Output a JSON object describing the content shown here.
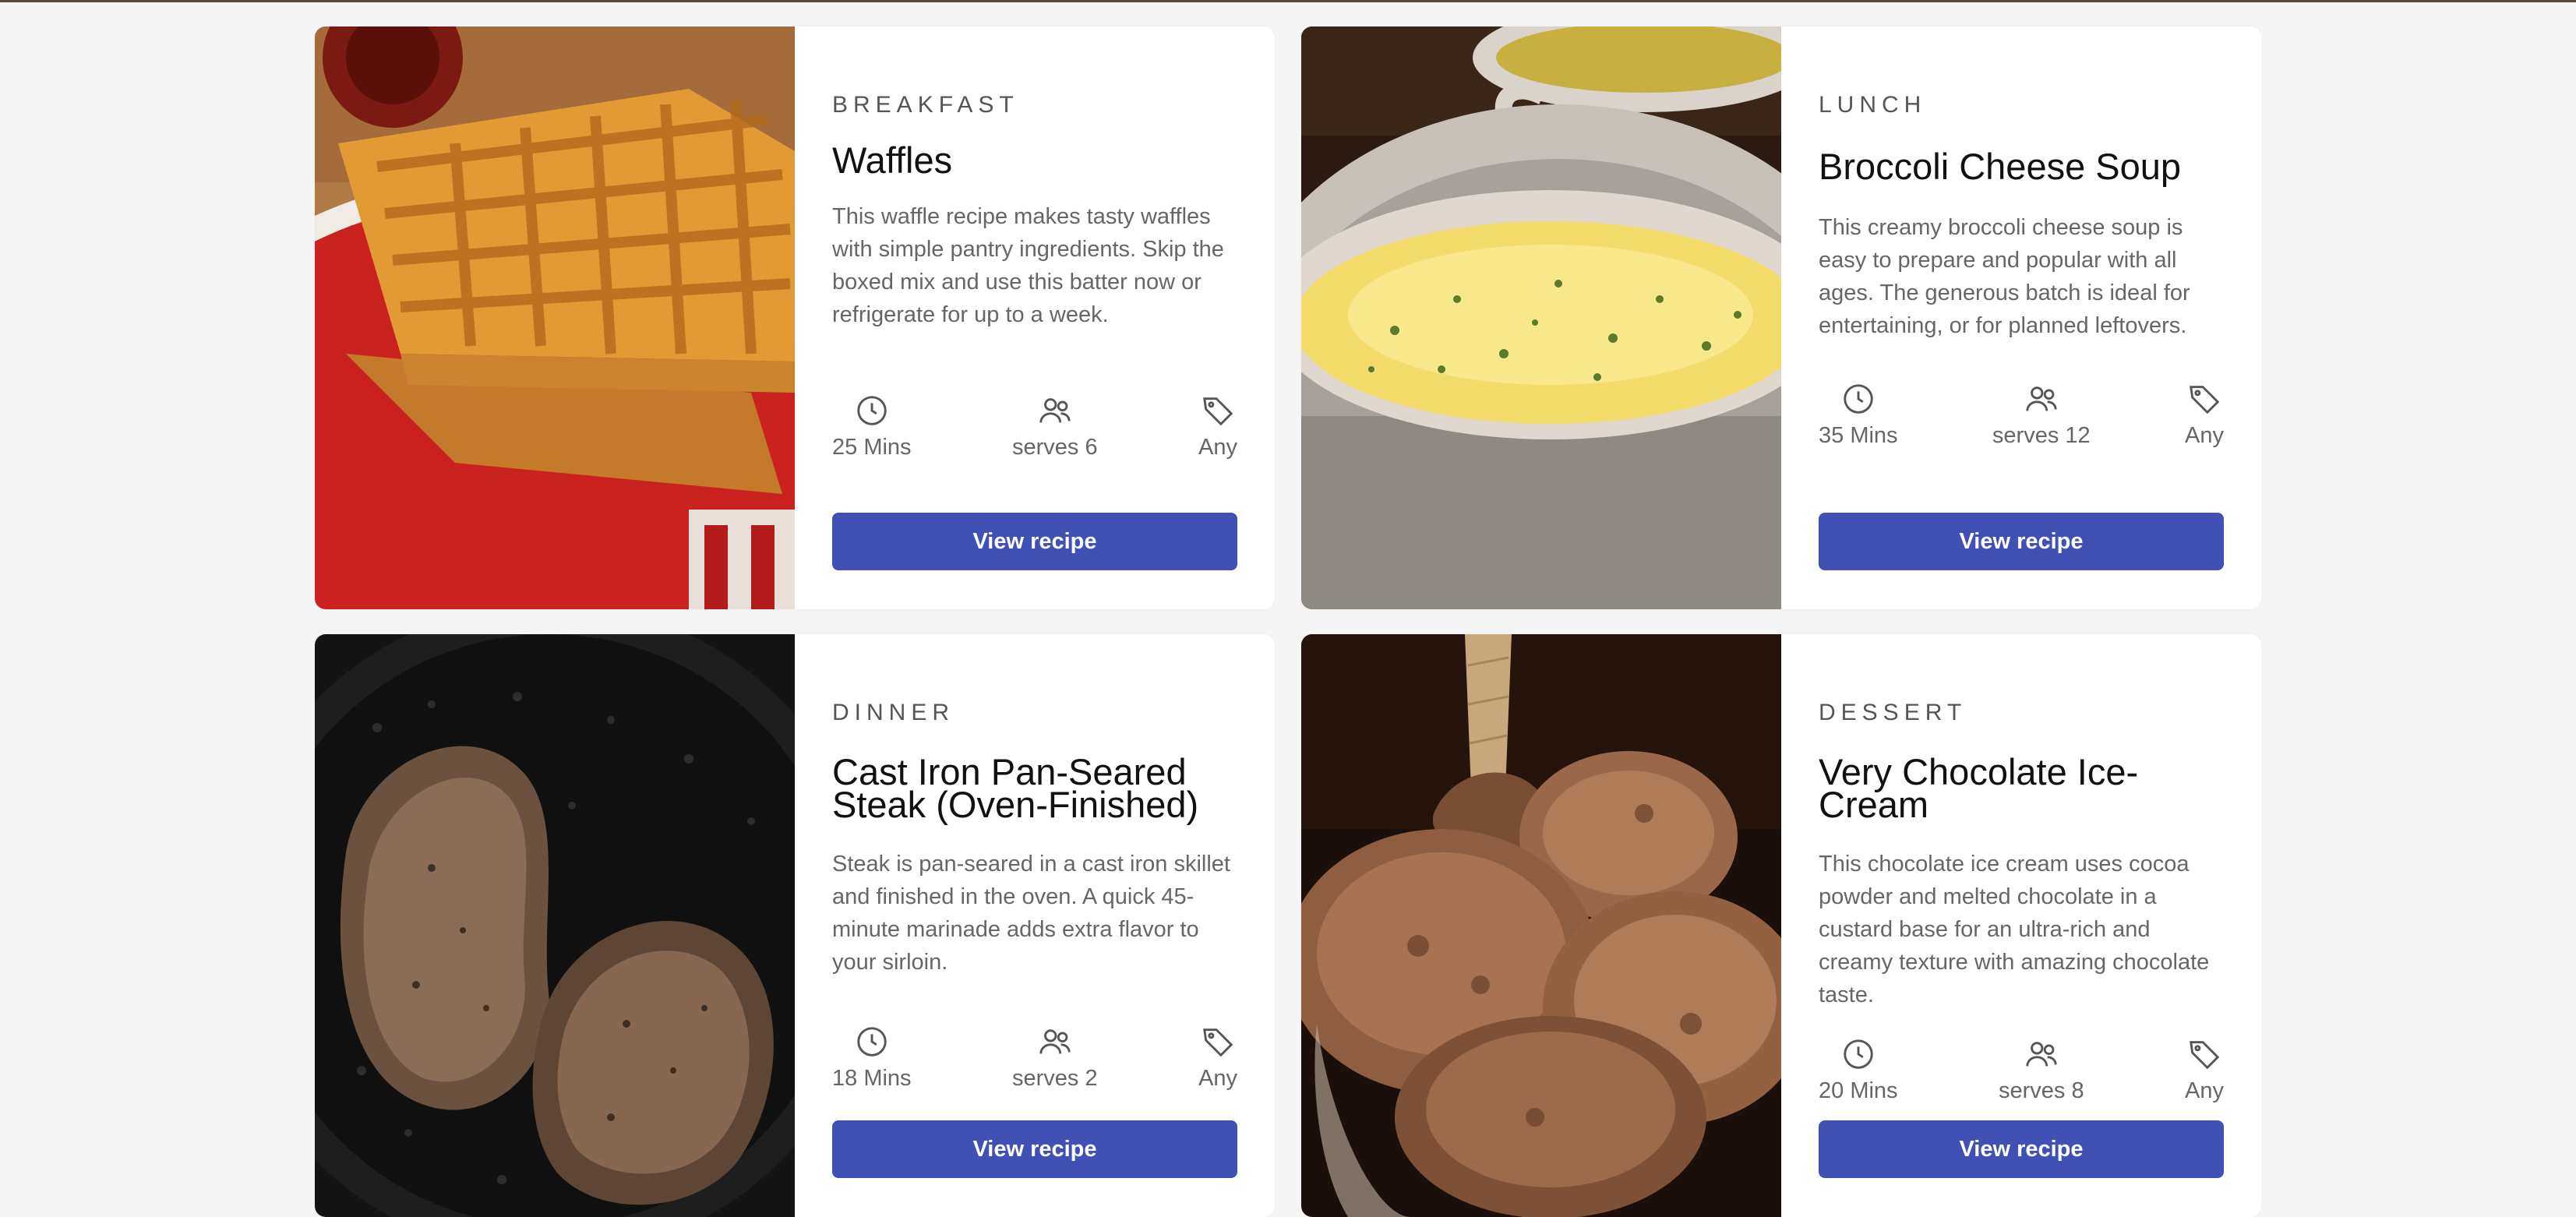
{
  "recipes": [
    {
      "category": "Breakfast",
      "title": "Waffles",
      "description": "This waffle recipe makes tasty waffles with simple pantry ingredients. Skip the boxed mix and use this batter now or refrigerate for up to a week.",
      "time": "25 Mins",
      "serves": "serves 6",
      "tag": "Any",
      "button": "View recipe",
      "image": "waffles-photo"
    },
    {
      "category": "Lunch",
      "title": "Broccoli Cheese Soup",
      "description": "This creamy broccoli cheese soup is easy to prepare and popular with all ages. The generous batch is ideal for entertaining, or for planned leftovers.",
      "time": "35 Mins",
      "serves": "serves 12",
      "tag": "Any",
      "button": "View recipe",
      "image": "soup-photo"
    },
    {
      "category": "Dinner",
      "title": "Cast Iron Pan-Seared Steak (Oven-Finished)",
      "description": "Steak is pan-seared in a cast iron skillet and finished in the oven. A quick 45-minute marinade adds extra flavor to your sirloin.",
      "time": "18 Mins",
      "serves": "serves 2",
      "tag": "Any",
      "button": "View recipe",
      "image": "steak-photo"
    },
    {
      "category": "Dessert",
      "title": "Very Chocolate Ice-Cream",
      "description": "This chocolate ice cream uses cocoa powder and melted chocolate in a custard base for an ultra-rich and creamy texture with amazing chocolate taste.",
      "time": "20 Mins",
      "serves": "serves 8",
      "tag": "Any",
      "button": "View recipe",
      "image": "icecream-photo"
    }
  ],
  "icons": {
    "time": "clock-icon",
    "serves": "users-icon",
    "tag": "tag-icon"
  },
  "colors": {
    "accent": "#3f51b5",
    "background": "#f5f5f5",
    "card": "#ffffff"
  }
}
